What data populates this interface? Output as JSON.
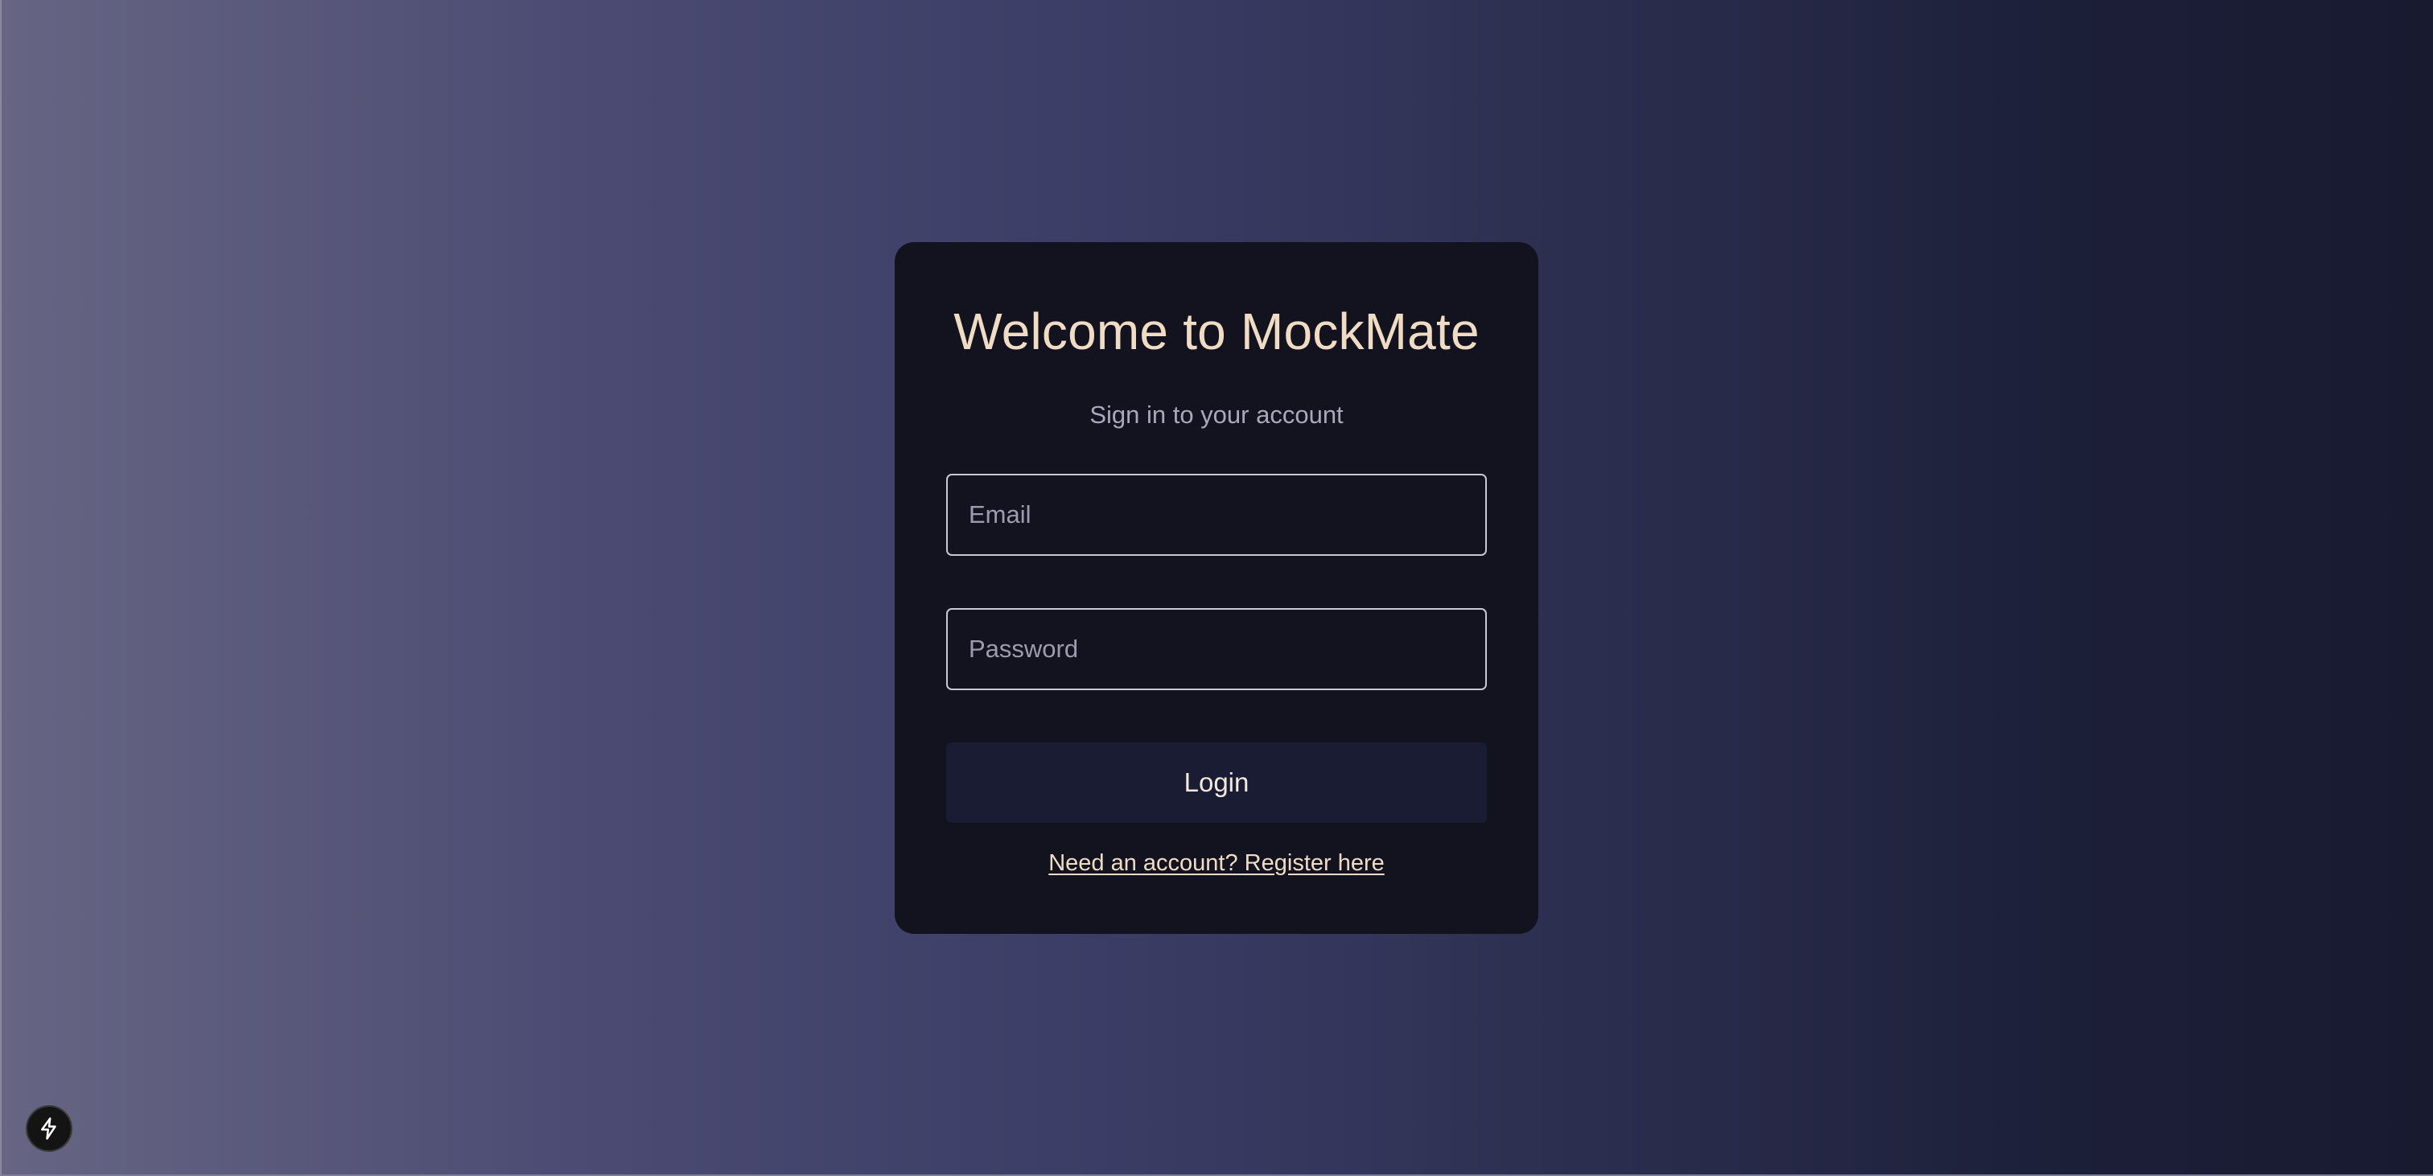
{
  "login_card": {
    "title": "Welcome to MockMate",
    "subtitle": "Sign in to your account",
    "email": {
      "value": "",
      "placeholder": "Email"
    },
    "password": {
      "value": "",
      "placeholder": "Password"
    },
    "login_label": "Login",
    "register_link": "Need an account? Register here"
  },
  "dev_badge": {
    "icon": "bolt-icon"
  },
  "colors": {
    "card_bg": "#13131f",
    "title": "#f0dcc4",
    "button_bg": "#1a1c33",
    "bg_left": "#666583",
    "bg_right": "#181a30"
  }
}
